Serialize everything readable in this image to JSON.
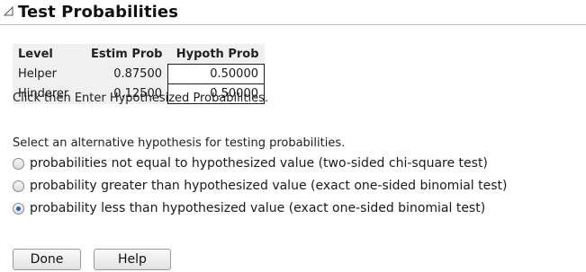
{
  "panel": {
    "title": "Test Probabilities",
    "disclosure_icon": "disclosure-triangle-open-icon"
  },
  "table": {
    "headers": [
      "Level",
      "Estim Prob",
      "Hypoth Prob"
    ],
    "rows": [
      {
        "level": "Helper",
        "estim": "0.87500",
        "hypoth": "0.50000"
      },
      {
        "level": "Hinderer",
        "estim": "0.12500",
        "hypoth": "0.50000"
      }
    ]
  },
  "instructions": "Click then Enter Hypothesized Probabilities.",
  "select_prompt": "Select an alternative hypothesis for testing probabilities.",
  "options": [
    {
      "label": "probabilities not equal to hypothesized value (two-sided chi-square test)",
      "checked": false
    },
    {
      "label": "probability greater than hypothesized value (exact one-sided binomial test)",
      "checked": false
    },
    {
      "label": "probability less than hypothesized value (exact one-sided binomial test)",
      "checked": true
    }
  ],
  "buttons": {
    "done": "Done",
    "help": "Help"
  }
}
